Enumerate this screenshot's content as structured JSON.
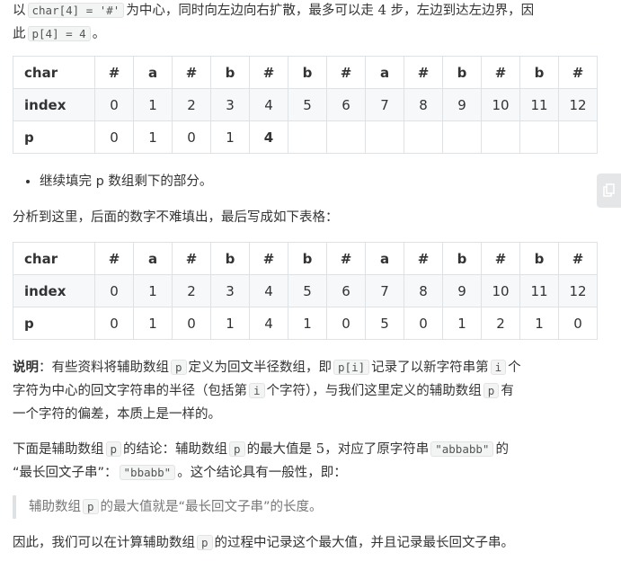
{
  "intro_line1": {
    "t1": "以",
    "code1": "char[4] = '#'",
    "t2": "为中心，同时向左边向右扩散，最多可以走",
    "num": "4",
    "t3": "步，左边到达左边界，因"
  },
  "intro_line2": {
    "t1": "此",
    "code1": "p[4] = 4",
    "t2": "。"
  },
  "table1": {
    "char_label": "char",
    "index_label": "index",
    "p_label": "p",
    "chars": [
      "#",
      "a",
      "#",
      "b",
      "#",
      "b",
      "#",
      "a",
      "#",
      "b",
      "#",
      "b",
      "#"
    ],
    "indices": [
      "0",
      "1",
      "2",
      "3",
      "4",
      "5",
      "6",
      "7",
      "8",
      "9",
      "10",
      "11",
      "12"
    ],
    "p": [
      "0",
      "1",
      "0",
      "1",
      "4",
      "",
      "",
      "",
      "",
      "",
      "",
      "",
      ""
    ]
  },
  "bullet": {
    "t1": "继续填完 p 数组剩下的部分。"
  },
  "para_analysis": "分析到这里，后面的数字不难填出，最后写成如下表格：",
  "table2": {
    "char_label": "char",
    "index_label": "index",
    "p_label": "p",
    "chars": [
      "#",
      "a",
      "#",
      "b",
      "#",
      "b",
      "#",
      "a",
      "#",
      "b",
      "#",
      "b",
      "#"
    ],
    "indices": [
      "0",
      "1",
      "2",
      "3",
      "4",
      "5",
      "6",
      "7",
      "8",
      "9",
      "10",
      "11",
      "12"
    ],
    "p": [
      "0",
      "1",
      "0",
      "1",
      "4",
      "1",
      "0",
      "5",
      "0",
      "1",
      "2",
      "1",
      "0"
    ]
  },
  "note": {
    "bold": "说明",
    "t1": "：有些资料将辅助数组",
    "code1": "p",
    "t2": "定义为回文半径数组，即",
    "code2": "p[i]",
    "t3": "记录了以新字符串第",
    "code3": "i",
    "t4": "个",
    "t5": "字符为中心的回文字符串的半径（包括第",
    "code4": "i",
    "t6": "个字符），与我们这里定义的辅助数组",
    "code5": "p",
    "t7": "有",
    "t8": "一个字符的偏差，本质上是一样的。"
  },
  "conclusion": {
    "t1": "下面是辅助数组",
    "code1": "p",
    "t2": "的结论：辅助数组",
    "code2": "p",
    "t3": "的最大值是",
    "num": "5",
    "t4": "，对应了原字符串",
    "code3": "\"abbabb\"",
    "t5": "的",
    "t6": "“最长回文子串”：",
    "code4": "\"bbabb\"",
    "t7": "。这个结论具有一般性，即："
  },
  "quote": {
    "t1": "辅助数组",
    "code1": "p",
    "t2": "的最大值就是“最长回文子串”的长度。"
  },
  "final": {
    "t1": "因此，我们可以在计算辅助数组",
    "code1": "p",
    "t2": "的过程中记录这个最大值，并且记录最长回文子串。"
  },
  "side_tab_icon": "copy-icon"
}
